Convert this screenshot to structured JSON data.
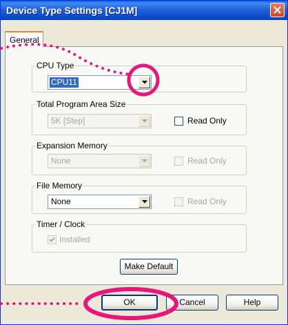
{
  "window": {
    "title": "Device Type Settings [CJ1M]"
  },
  "tabs": [
    {
      "label": "General"
    }
  ],
  "cpu_type": {
    "legend": "CPU Type",
    "value": "CPU11"
  },
  "program_area": {
    "legend": "Total Program Area Size",
    "value": "5K [Step]",
    "read_only_label": "Read Only"
  },
  "expansion_memory": {
    "legend": "Expansion Memory",
    "value": "None",
    "read_only_label": "Read Only"
  },
  "file_memory": {
    "legend": "File Memory",
    "value": "None",
    "read_only_label": "Read Only"
  },
  "timer_clock": {
    "legend": "Timer / Clock",
    "installed_label": "Installed"
  },
  "buttons": {
    "make_default": "Make Default",
    "ok": "OK",
    "cancel": "Cancel",
    "help": "Help"
  },
  "colors": {
    "annotation_accent": "#e8167a",
    "title_blue": "#0054e3"
  }
}
